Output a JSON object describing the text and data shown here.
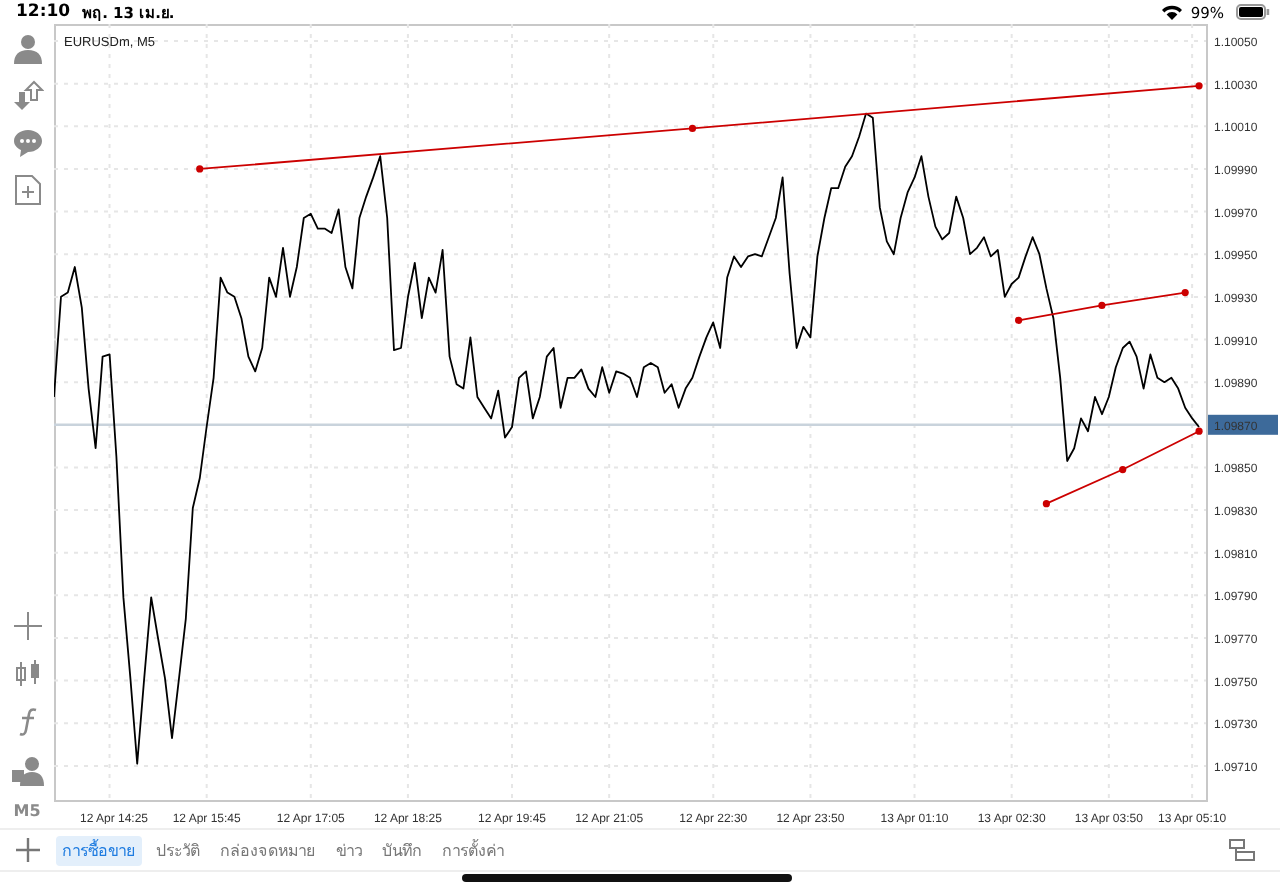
{
  "status_bar": {
    "time": "12:10",
    "date": "พฤ. 13 เม.ย.",
    "battery": "99%"
  },
  "timeframe_button": "M5",
  "chart": {
    "chart_data": {
      "type": "line",
      "title": "EURUSDm, M5",
      "categories": [
        null,
        null,
        null,
        null,
        null,
        null,
        null,
        null,
        "12 Apr 14:25",
        null,
        null,
        null,
        null,
        null,
        null,
        null,
        null,
        null,
        null,
        null,
        null,
        null,
        "12 Apr 15:45",
        null,
        null,
        null,
        null,
        null,
        null,
        null,
        null,
        null,
        null,
        null,
        null,
        null,
        null,
        "12 Apr 17:05",
        null,
        null,
        null,
        null,
        null,
        null,
        null,
        null,
        null,
        null,
        null,
        null,
        null,
        "12 Apr 18:25",
        null,
        null,
        null,
        null,
        null,
        null,
        null,
        null,
        null,
        null,
        null,
        null,
        null,
        null,
        "12 Apr 19:45",
        null,
        null,
        null,
        null,
        null,
        null,
        null,
        null,
        null,
        null,
        null,
        null,
        null,
        "12 Apr 21:05",
        null,
        null,
        null,
        null,
        null,
        null,
        null,
        null,
        null,
        null,
        null,
        null,
        null,
        null,
        "12 Apr 22:30",
        null,
        null,
        null,
        null,
        null,
        null,
        null,
        null,
        null,
        null,
        null,
        null,
        null,
        "12 Apr 23:50",
        null,
        null,
        null,
        null,
        null,
        null,
        null,
        null,
        null,
        null,
        null,
        null,
        null,
        null,
        "13 Apr 01:10",
        null,
        null,
        null,
        null,
        null,
        null,
        null,
        null,
        null,
        null,
        null,
        null,
        null,
        "13 Apr 02:30",
        null,
        null,
        null,
        null,
        null,
        null,
        null,
        null,
        null,
        null,
        null,
        null,
        null,
        "13 Apr 03:50",
        null,
        null,
        null,
        null,
        null,
        null,
        null,
        null,
        null,
        null,
        null,
        "13 Apr 05:10",
        null
      ],
      "series": [
        {
          "color": "#c9d3dc",
          "values": [
            1.0987,
            1.0987,
            1.0987,
            1.0987,
            1.0987,
            1.0987,
            1.0987,
            1.0987,
            1.0987,
            1.0987,
            1.0987,
            1.0987,
            1.0987,
            1.0987,
            1.0987,
            1.0987,
            1.0987,
            1.0987,
            1.0987,
            1.0987,
            1.0987,
            1.0987,
            1.0987,
            1.0987,
            1.0987,
            1.0987,
            1.0987,
            1.0987,
            1.0987,
            1.0987,
            1.0987,
            1.0987,
            1.0987,
            1.0987,
            1.0987,
            1.0987,
            1.0987,
            1.0987,
            1.0987,
            1.0987,
            1.0987,
            1.0987,
            1.0987,
            1.0987,
            1.0987,
            1.0987,
            1.0987,
            1.0987,
            1.0987,
            1.0987,
            1.0987,
            1.0987,
            1.0987,
            1.0987,
            1.0987,
            1.0987,
            1.0987,
            1.0987,
            1.0987,
            1.0987,
            1.0987,
            1.0987,
            1.0987,
            1.0987,
            1.0987,
            1.0987,
            1.0987,
            1.0987,
            1.0987,
            1.0987,
            1.0987,
            1.0987,
            1.0987,
            1.0987,
            1.0987,
            1.0987,
            1.0987,
            1.0987,
            1.0987,
            1.0987,
            1.0987,
            1.0987,
            1.0987,
            1.0987,
            1.0987,
            1.0987,
            1.0987,
            1.0987,
            1.0987,
            1.0987,
            1.0987,
            1.0987,
            1.0987,
            1.0987,
            1.0987,
            1.0987,
            1.0987,
            1.0987,
            1.0987,
            1.0987,
            1.0987,
            1.0987,
            1.0987,
            1.0987,
            1.0987,
            1.0987,
            1.0987,
            1.0987,
            1.0987,
            1.0987,
            1.0987,
            1.0987,
            1.0987,
            1.0987,
            1.0987,
            1.0987,
            1.0987,
            1.0987,
            1.0987,
            1.0987,
            1.0987,
            1.0987,
            1.0987,
            1.0987,
            1.0987,
            1.0987,
            1.0987,
            1.0987,
            1.0987,
            1.0987,
            1.0987,
            1.0987,
            1.0987,
            1.0987,
            1.0987,
            1.0987,
            1.0987,
            1.0987,
            1.0987,
            1.0987,
            1.0987,
            1.0987,
            1.0987,
            1.0987,
            1.0987,
            1.0987,
            1.0987,
            1.0987,
            1.0987,
            1.0987,
            1.0987,
            1.0987,
            1.0987,
            1.0987,
            1.0987,
            1.0987,
            1.0987,
            1.0987,
            1.0987,
            1.0987,
            1.0987,
            1.0987,
            1.0987,
            1.0987,
            1.0987,
            1.0987
          ]
        },
        {
          "color": "#000000",
          "values": [
            1.09883,
            1.0993,
            1.09932,
            1.09944,
            1.09925,
            1.09887,
            1.09859,
            1.09902,
            1.09903,
            1.09855,
            1.09789,
            1.09751,
            1.09711,
            1.09751,
            1.09789,
            1.0977,
            1.09751,
            1.09723,
            1.09751,
            1.09779,
            1.09831,
            1.09845,
            1.09869,
            1.09892,
            1.09939,
            1.09932,
            1.0993,
            1.0992,
            1.09902,
            1.09895,
            1.09906,
            1.09939,
            1.0993,
            1.09953,
            1.0993,
            1.09944,
            1.09967,
            1.09969,
            1.09962,
            1.09962,
            1.0996,
            1.09971,
            1.09944,
            1.09934,
            1.09967,
            1.09977,
            1.09986,
            1.09996,
            1.09967,
            1.09905,
            1.09906,
            1.0993,
            1.09946,
            1.0992,
            1.09939,
            1.09932,
            1.09952,
            1.09902,
            1.09889,
            1.09887,
            1.09911,
            1.09883,
            1.09878,
            1.09873,
            1.09886,
            1.09864,
            1.09869,
            1.09892,
            1.09895,
            1.09873,
            1.09883,
            1.09902,
            1.09906,
            1.09878,
            1.09892,
            1.09892,
            1.09896,
            1.09887,
            1.09883,
            1.09897,
            1.09885,
            1.09895,
            1.09894,
            1.09892,
            1.09883,
            1.09897,
            1.09899,
            1.09897,
            1.09885,
            1.09889,
            1.09878,
            1.09887,
            1.09892,
            1.09902,
            1.09911,
            1.09918,
            1.09906,
            1.09939,
            1.09949,
            1.09944,
            1.09949,
            1.0995,
            1.09949,
            1.09958,
            1.09967,
            1.09986,
            1.09941,
            1.09906,
            1.09916,
            1.09911,
            1.09949,
            1.09967,
            1.09981,
            1.09981,
            1.09991,
            1.09996,
            1.10005,
            1.10016,
            1.10014,
            1.09972,
            1.09956,
            1.0995,
            1.09967,
            1.09979,
            1.09986,
            1.09996,
            1.09977,
            1.09963,
            1.09957,
            1.0996,
            1.09977,
            1.09967,
            1.0995,
            1.09953,
            1.09958,
            1.09949,
            1.09952,
            1.0993,
            1.09936,
            1.09939,
            1.09949,
            1.09958,
            1.0995,
            1.09934,
            1.0992,
            1.09892,
            1.09853,
            1.09859,
            1.09873,
            1.09867,
            1.09883,
            1.09875,
            1.09883,
            1.09897,
            1.09906,
            1.09909,
            1.09902,
            1.09887,
            1.09903,
            1.09892,
            1.0989,
            1.09892,
            1.09887,
            1.09878,
            1.09873,
            1.09869
          ]
        },
        {
          "color": "#cc0000",
          "marker": true,
          "values": [
            null,
            null,
            null,
            null,
            null,
            null,
            null,
            null,
            null,
            null,
            null,
            null,
            null,
            null,
            null,
            null,
            null,
            null,
            null,
            null,
            null,
            1.0999,
            null,
            null,
            null,
            null,
            null,
            null,
            null,
            null,
            null,
            null,
            null,
            null,
            null,
            null,
            null,
            null,
            null,
            null,
            null,
            null,
            null,
            null,
            null,
            null,
            null,
            null,
            null,
            null,
            null,
            null,
            null,
            null,
            null,
            null,
            null,
            null,
            null,
            null,
            null,
            null,
            null,
            null,
            null,
            null,
            null,
            null,
            null,
            null,
            null,
            null,
            null,
            null,
            null,
            null,
            null,
            null,
            null,
            null,
            null,
            null,
            null,
            null,
            null,
            null,
            null,
            null,
            null,
            null,
            null,
            null,
            1.10009,
            null,
            null,
            null,
            null,
            null,
            null,
            null,
            null,
            null,
            null,
            null,
            null,
            null,
            null,
            null,
            null,
            null,
            null,
            null,
            null,
            null,
            null,
            null,
            null,
            null,
            null,
            null,
            null,
            null,
            null,
            null,
            null,
            null,
            null,
            null,
            null,
            null,
            null,
            null,
            null,
            null,
            null,
            null,
            null,
            null,
            null,
            null,
            null,
            null,
            null,
            null,
            null,
            null,
            null,
            null,
            null,
            null,
            null,
            null,
            null,
            null,
            null,
            null,
            null,
            null,
            null,
            null,
            null,
            null,
            null,
            null,
            null,
            1.10029
          ]
        },
        {
          "color": "#cc0000",
          "marker": true,
          "values": [
            null,
            null,
            null,
            null,
            null,
            null,
            null,
            null,
            null,
            null,
            null,
            null,
            null,
            null,
            null,
            null,
            null,
            null,
            null,
            null,
            null,
            null,
            null,
            null,
            null,
            null,
            null,
            null,
            null,
            null,
            null,
            null,
            null,
            null,
            null,
            null,
            null,
            null,
            null,
            null,
            null,
            null,
            null,
            null,
            null,
            null,
            null,
            null,
            null,
            null,
            null,
            null,
            null,
            null,
            null,
            null,
            null,
            null,
            null,
            null,
            null,
            null,
            null,
            null,
            null,
            null,
            null,
            null,
            null,
            null,
            null,
            null,
            null,
            null,
            null,
            null,
            null,
            null,
            null,
            null,
            null,
            null,
            null,
            null,
            null,
            null,
            null,
            null,
            null,
            null,
            null,
            null,
            null,
            null,
            null,
            null,
            null,
            null,
            null,
            null,
            null,
            null,
            null,
            null,
            null,
            null,
            null,
            null,
            null,
            null,
            null,
            null,
            null,
            null,
            null,
            null,
            null,
            null,
            null,
            null,
            null,
            null,
            null,
            null,
            null,
            null,
            null,
            null,
            null,
            null,
            null,
            null,
            null,
            null,
            null,
            null,
            null,
            null,
            null,
            1.09919,
            null,
            null,
            null,
            null,
            null,
            null,
            null,
            null,
            null,
            null,
            null,
            1.09926,
            null,
            null,
            null,
            null,
            null,
            null,
            null,
            null,
            null,
            null,
            null,
            1.09932,
            null,
            null
          ]
        },
        {
          "color": "#cc0000",
          "marker": true,
          "values": [
            null,
            null,
            null,
            null,
            null,
            null,
            null,
            null,
            null,
            null,
            null,
            null,
            null,
            null,
            null,
            null,
            null,
            null,
            null,
            null,
            null,
            null,
            null,
            null,
            null,
            null,
            null,
            null,
            null,
            null,
            null,
            null,
            null,
            null,
            null,
            null,
            null,
            null,
            null,
            null,
            null,
            null,
            null,
            null,
            null,
            null,
            null,
            null,
            null,
            null,
            null,
            null,
            null,
            null,
            null,
            null,
            null,
            null,
            null,
            null,
            null,
            null,
            null,
            null,
            null,
            null,
            null,
            null,
            null,
            null,
            null,
            null,
            null,
            null,
            null,
            null,
            null,
            null,
            null,
            null,
            null,
            null,
            null,
            null,
            null,
            null,
            null,
            null,
            null,
            null,
            null,
            null,
            null,
            null,
            null,
            null,
            null,
            null,
            null,
            null,
            null,
            null,
            null,
            null,
            null,
            null,
            null,
            null,
            null,
            null,
            null,
            null,
            null,
            null,
            null,
            null,
            null,
            null,
            null,
            null,
            null,
            null,
            null,
            null,
            null,
            null,
            null,
            null,
            null,
            null,
            null,
            null,
            null,
            null,
            null,
            null,
            null,
            null,
            null,
            null,
            null,
            null,
            null,
            1.09833,
            null,
            null,
            null,
            null,
            null,
            null,
            null,
            null,
            null,
            null,
            1.09849,
            null,
            null,
            null,
            null,
            null,
            null,
            null,
            null,
            null,
            null,
            1.09867
          ]
        }
      ],
      "ylim": [
        1.09694,
        1.10058
      ],
      "yticks": [
        {
          "value": 1.1005,
          "label": "1.10050"
        },
        {
          "value": 1.1003,
          "label": "1.10030"
        },
        {
          "value": 1.1001,
          "label": "1.10010"
        },
        {
          "value": 1.0999,
          "label": "1.09990"
        },
        {
          "value": 1.0997,
          "label": "1.09970"
        },
        {
          "value": 1.0995,
          "label": "1.09950"
        },
        {
          "value": 1.0993,
          "label": "1.09930"
        },
        {
          "value": 1.0991,
          "label": "1.09910"
        },
        {
          "value": 1.0989,
          "label": "1.09890"
        },
        {
          "value": 1.0985,
          "label": "1.09850"
        },
        {
          "value": 1.0983,
          "label": "1.09830"
        },
        {
          "value": 1.0981,
          "label": "1.09810"
        },
        {
          "value": 1.0979,
          "label": "1.09790"
        },
        {
          "value": 1.0977,
          "label": "1.09770"
        },
        {
          "value": 1.0975,
          "label": "1.09750"
        },
        {
          "value": 1.0973,
          "label": "1.09730"
        },
        {
          "value": 1.0971,
          "label": "1.09710"
        }
      ],
      "grid": true
    },
    "current_price": "1.09870"
  },
  "tabs": [
    {
      "label": "การซื้อขาย",
      "selected": true
    },
    {
      "label": "ประวัติ",
      "selected": false
    },
    {
      "label": "กล่องจดหมาย",
      "selected": false
    },
    {
      "label": "ข่าว",
      "selected": false
    },
    {
      "label": "บันทึก",
      "selected": false
    },
    {
      "label": "การตั้งค่า",
      "selected": false
    }
  ]
}
